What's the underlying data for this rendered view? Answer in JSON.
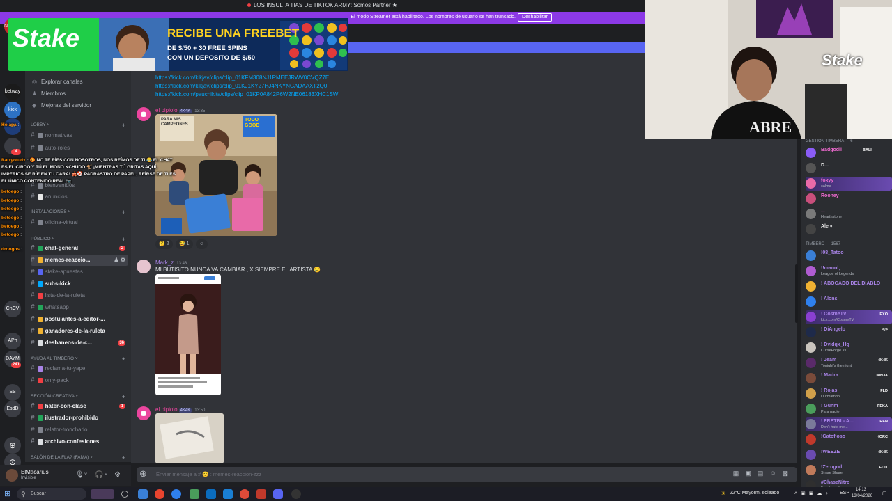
{
  "window": {
    "title": "LOS INSULTA TIAS DE TIKTOK ARMY: Somos Partner ★"
  },
  "streamer_mode": {
    "text": "El modo Streamer está habilitado. Los nombres de usuario se han truncado.",
    "button": "Deshabilitar"
  },
  "ad": {
    "brand": "Stake",
    "headline": "RECIBE UNA FREEBET",
    "line1": "DE $/50 + 30 FREE SPINS",
    "line2": "CON UN DEPOSITO DE $/50",
    "colors": {
      "bg": "#0d2a5a",
      "green": "#1fce48"
    }
  },
  "servers": [
    {
      "label": "NUEVO",
      "badge": ""
    },
    {
      "label": "betway",
      "badge": ""
    },
    {
      "label": "kick",
      "badge": ""
    },
    {
      "label": "M",
      "badge": ""
    },
    {
      "label": "",
      "badge": "4"
    },
    {
      "label": "CnCV",
      "badge": ""
    },
    {
      "label": "APh",
      "badge": ""
    },
    {
      "label": "DAYM",
      "badge": "241"
    },
    {
      "label": "SS",
      "badge": ""
    },
    {
      "label": "EsdD",
      "badge": ""
    }
  ],
  "sidebar": {
    "nav": [
      {
        "icon": "compass-icon",
        "label": "Explorar canales"
      },
      {
        "icon": "members-icon",
        "label": "Miembros"
      },
      {
        "icon": "boost-icon",
        "label": "Mejoras del servidor"
      }
    ],
    "categories": [
      {
        "label": "LOBBY"
      },
      {
        "label": "INSTALACIONES"
      },
      {
        "label": "PÚBLICO"
      },
      {
        "label": "AYUDA AL TIMBERO"
      },
      {
        "label": "SECCIÓN CREATIVA"
      },
      {
        "label": "SALÓN DE LA FLA? (FAMA)"
      }
    ],
    "channels": [
      {
        "name": "normativas",
        "bold": false,
        "badge": "",
        "color": "#80848e"
      },
      {
        "name": "auto-roles",
        "bold": false,
        "badge": "",
        "color": "#80848e"
      },
      {
        "name": "bienvenidos",
        "bold": false,
        "badge": "",
        "color": "#80848e"
      },
      {
        "name": "anuncios",
        "bold": false,
        "badge": "",
        "color": "#e8e8e8"
      },
      {
        "name": "oficina-virtual",
        "bold": false,
        "badge": "",
        "color": "#80848e"
      },
      {
        "name": "chat-general",
        "bold": true,
        "badge": "2",
        "color": "#23a55a"
      },
      {
        "name": "memes-reaccio...",
        "bold": true,
        "badge": "",
        "color": "#f0b232"
      },
      {
        "name": "stake-apuestas",
        "bold": false,
        "badge": "",
        "color": "#5865f2"
      },
      {
        "name": "subs-kick",
        "bold": true,
        "badge": "",
        "color": "#00a8fc"
      },
      {
        "name": "lista-de-la-ruleta",
        "bold": false,
        "badge": "",
        "color": "#f23f43"
      },
      {
        "name": "whatsapp",
        "bold": false,
        "badge": "",
        "color": "#23a55a"
      },
      {
        "name": "postulantes-a-editor-...",
        "bold": true,
        "badge": "",
        "color": "#f0b232"
      },
      {
        "name": "ganadores-de-la-ruleta",
        "bold": true,
        "badge": "",
        "color": "#f0b232"
      },
      {
        "name": "desbaneos-de-c...",
        "bold": true,
        "badge": "36",
        "color": "#dbdee1"
      },
      {
        "name": "reclama-tu-yape",
        "bold": false,
        "badge": "",
        "color": "#a883e6"
      },
      {
        "name": "only-pack",
        "bold": false,
        "badge": "",
        "color": "#f23f43"
      },
      {
        "name": "hater-con-clase",
        "bold": true,
        "badge": "1",
        "color": "#f23f43"
      },
      {
        "name": "ilustrador-prohibido",
        "bold": true,
        "badge": "",
        "color": "#23a55a"
      },
      {
        "name": "relator-tronchado",
        "bold": false,
        "badge": "",
        "color": "#80848e"
      },
      {
        "name": "archivo-confesiones",
        "bold": true,
        "badge": "",
        "color": "#dbdee1"
      }
    ]
  },
  "overlay_chat": [
    {
      "user": "Holapa",
      "text": ":"
    },
    {
      "user": "Barryotudx",
      "text": ": 😡 NO TE RÍES CON NOSOTROS, NOS REÍMOS DE TI 😂 EL CHAT ES EL CIRCO Y TÚ EL MONO KCHUDO 🐒 ¡MIENTRAS TÚ GRITAS AQUÍ, IMPERIOS SE RÍE EN TU CARA! 🎪🤡 PADRASTRO DE PAPEL, REÍRSE DE TI ES EL ÚNICO CONTENIDO REAL 📷"
    },
    {
      "user": "betoego",
      "text": ":"
    },
    {
      "user": "betoego",
      "text": ":"
    },
    {
      "user": "betoego",
      "text": ":"
    },
    {
      "user": "betoego",
      "text": ":"
    },
    {
      "user": "betoego",
      "text": ":"
    },
    {
      "user": "betoego",
      "text": ":"
    },
    {
      "user": "droogos",
      "text": ":"
    }
  ],
  "messages": {
    "links": [
      "https://kick.com/kikjav/clips/clip_01KFM308NJ1PMEEJRWV0CVQZ7E",
      "https://kick.com/kikjav/clips/clip_01KJ1KY27HJ4NKYNGADAAXT2Q0",
      "https://kick.com/pauchikita/clips/clip_01KP0A842P6W2NE06183XHC1SW"
    ],
    "msg1": {
      "author": "el pipiolo",
      "tag": "4K4K",
      "time": "13:35",
      "image_text": "PARA MIS CAMPEONES",
      "image_tag": "TODO GOOD",
      "reactions": [
        "🤔 2",
        "😂 1",
        "☺"
      ]
    },
    "msg2": {
      "author": "Mark_z",
      "time": "13:43",
      "text": "MI BUTISITO NUNCA VA CAMBIAR , X SIEMPRE EL ARTISTA 😢"
    },
    "msg3": {
      "author": "el pipiolo",
      "tag": "4K4K",
      "time": "13:50"
    }
  },
  "input": {
    "placeholder": "Enviar mensaje a # 😊 : memes-reaccion-zzz"
  },
  "user_panel": {
    "name": "ElMacarius",
    "status": "Invisible"
  },
  "member_list": {
    "cat1": "GESTIÓN TIMBERA — 6",
    "cat2": "TIMBERO — 1567",
    "top": [
      {
        "name": "Badgodii",
        "status": "",
        "tag": "BALI",
        "color": "#f06bd1"
      },
      {
        "name": "D...",
        "status": "",
        "tag": "",
        "color": "#e8e8e8"
      },
      {
        "name": "foxyy",
        "status": "calma",
        "tag": "",
        "color": "#f06bd1"
      },
      {
        "name": "Rooney",
        "status": "",
        "tag": "",
        "color": "#f06bd1"
      },
      {
        "name": "...",
        "status": "Hearthstone",
        "tag": "",
        "color": "#f06bd1"
      },
      {
        "name": "Ale ♦",
        "status": "",
        "tag": "",
        "color": "#e8e8e8"
      }
    ],
    "members": [
      {
        "name": "!08_Tatoo",
        "status": "",
        "tag": ""
      },
      {
        "name": "!!manol;",
        "status": "League of Legends",
        "tag": ""
      },
      {
        "name": "! ABOGADO DEL DIABLO",
        "status": "",
        "tag": ""
      },
      {
        "name": "! Alons",
        "status": "",
        "tag": ""
      },
      {
        "name": "! CosmeTV",
        "status": "kick.com/CosmeTV",
        "tag": "EXO"
      },
      {
        "name": "! DiAngelo",
        "status": "",
        "tag": "</>"
      },
      {
        "name": "! Dvidqx_Hg",
        "status": "CurseForge ×1",
        "tag": ""
      },
      {
        "name": "! Jeam",
        "status": "Tonight's the night",
        "tag": "4K4K"
      },
      {
        "name": "! Madra",
        "status": "",
        "tag": "NINJA"
      },
      {
        "name": "! Rojas",
        "status": "Durmiendo",
        "tag": "FLD"
      },
      {
        "name": "! Gunm",
        "status": "Para nadie",
        "tag": "FEKA"
      },
      {
        "name": "! FRETBL- A...",
        "status": "Don't hate me...",
        "tag": "REN"
      },
      {
        "name": "!Gatofioso",
        "status": "",
        "tag": "HORC"
      },
      {
        "name": "!WEEZE",
        "status": "",
        "tag": "4K4K"
      },
      {
        "name": "!Zerogod",
        "status": "Share Share",
        "tag": "EDIT"
      },
      {
        "name": "#ChaseNitro",
        "status": "I'm closer than you realize",
        "tag": ""
      }
    ]
  },
  "taskbar": {
    "search_label": "Buscar",
    "weather": "22°C Mayorm. soleado",
    "lang": "ESP",
    "time": "14:13",
    "date": "13/04/2026"
  }
}
